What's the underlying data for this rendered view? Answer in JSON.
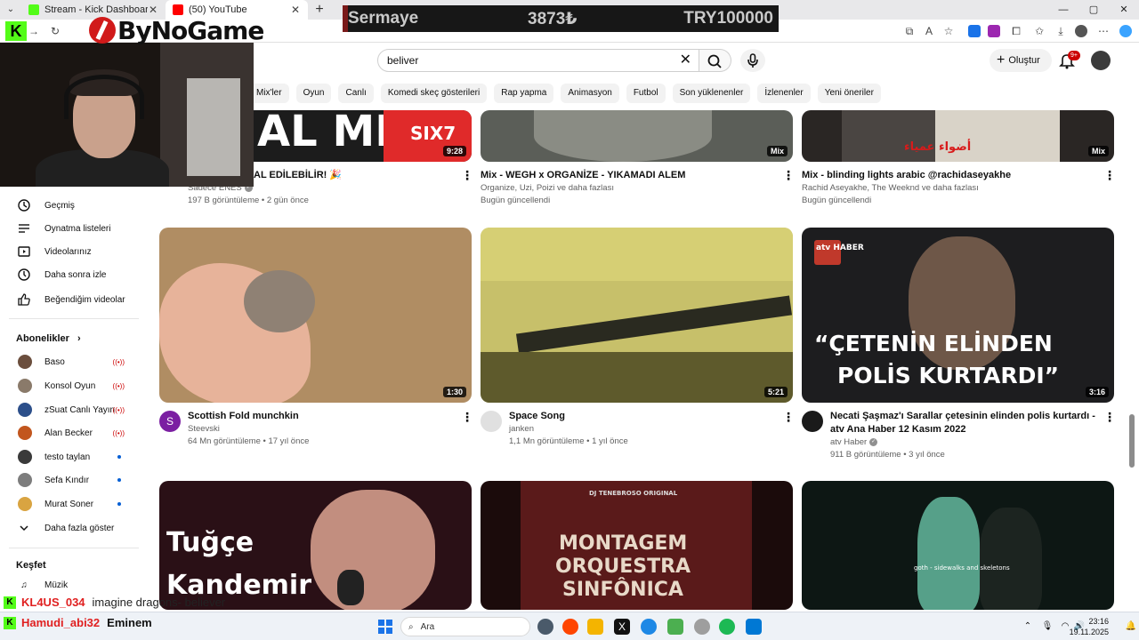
{
  "browser": {
    "tabs": [
      {
        "label": "Stream - Kick Dashboard",
        "active": false,
        "icon_color": "#53fc18"
      },
      {
        "label": "(50) YouTube",
        "active": true,
        "icon_color": "#ff0000"
      }
    ],
    "new_tab_symbol": "+",
    "window_controls": {
      "minimize": "—",
      "maximize": "▢",
      "close": "✕"
    }
  },
  "overlay": {
    "sermaye_label": "Sermaye",
    "sermaye_value": "3873₺",
    "sermaye_target": "TRY100000",
    "logo_text": "ByNoGame",
    "kick_badge": "K"
  },
  "youtube": {
    "search": {
      "value": "beliver",
      "placeholder": "Ara"
    },
    "create_label": "Oluştur",
    "notifications_badge": "9+",
    "chips": [
      "Mix'ler",
      "Oyun",
      "Canlı",
      "Komedi skeç gösterileri",
      "Rap yapma",
      "Animasyon",
      "Futbol",
      "Son yüklenenler",
      "İzlenenler",
      "Yeni öneriler"
    ]
  },
  "sidebar": {
    "you_items": [
      {
        "label": "Geçmiş",
        "icon": "history-icon"
      },
      {
        "label": "Oynatma listeleri",
        "icon": "playlist-icon"
      },
      {
        "label": "Videolarınız",
        "icon": "your-videos-icon"
      },
      {
        "label": "Daha sonra izle",
        "icon": "watch-later-icon"
      },
      {
        "label": "Beğendiğim videolar",
        "icon": "like-icon"
      }
    ],
    "subscriptions_heading": "Abonelikler",
    "subscriptions": [
      {
        "label": "Baso",
        "status": "live",
        "avatar_color": "#6b4e3d"
      },
      {
        "label": "Konsol Oyun",
        "status": "live",
        "avatar_color": "#8a7a6a"
      },
      {
        "label": "zSuat Canlı Yayın",
        "status": "live",
        "avatar_color": "#2c4f8a"
      },
      {
        "label": "Alan Becker",
        "status": "live",
        "avatar_color": "#c2561e"
      },
      {
        "label": "testo taylan",
        "status": "new",
        "avatar_color": "#3a3a3a"
      },
      {
        "label": "Sefa Kındır",
        "status": "new",
        "avatar_color": "#7d7d7d"
      },
      {
        "label": "Murat Soner",
        "status": "new",
        "avatar_color": "#d9a441"
      }
    ],
    "show_more_label": "Daha fazla göster",
    "explore_heading": "Keşfet",
    "explore_items": [
      {
        "label": "Müzik",
        "icon": "music-icon"
      }
    ]
  },
  "videos": {
    "row1": [
      {
        "title": "AL EDİLEBİLİR! 🎉",
        "channel": "Sadece ENES",
        "meta": "197 B görüntüleme • 2 gün önce",
        "duration": "9:28",
        "verified": true
      },
      {
        "title": "Mix - WEGH x ORGANİZE - YIKAMADI ALEM",
        "channel": "Organize, Uzi, Poizi ve daha fazlası",
        "meta": "Bugün güncellendi",
        "duration": "Mix"
      },
      {
        "title": "Mix - blinding lights arabic @rachidaseyakhe",
        "channel": "Rachid Aseyakhe, The Weeknd ve daha fazlası",
        "meta": "Bugün güncellendi",
        "duration": "Mix"
      }
    ],
    "row2": [
      {
        "title": "Scottish Fold munchkin",
        "channel": "Steevski",
        "meta": "64 Mn görüntüleme • 17 yıl önce",
        "duration": "1:30",
        "avatar_letter": "S",
        "avatar_color": "#7b1fa2"
      },
      {
        "title": "Space Song",
        "channel": "janken",
        "meta": "1,1 Mn görüntüleme • 1 yıl önce",
        "duration": "5:21",
        "avatar_letter": "",
        "avatar_color": "#e0e0e0"
      },
      {
        "title": "Necati Şaşmaz'ı Sarallar çetesinin elinden polis kurtardı - atv Ana Haber 12 Kasım 2022",
        "channel": "atv Haber",
        "meta": "911 B görüntüleme • 3 yıl önce",
        "duration": "3:16",
        "avatar_letter": "",
        "avatar_color": "#1a1a1a",
        "verified": true
      }
    ],
    "thumb_texts": {
      "r1a": "AL MI?",
      "r1a_brand": "SIX7",
      "r1c_arabic": "أضواء عمياء",
      "r2c_logo": "atv HABER",
      "r2c_quote_1": "“ÇETENİN ELİNDEN",
      "r2c_quote_2": "POLİS KURTARDI”",
      "r3a_1": "Tuğçe",
      "r3a_2": "Kandemir",
      "r3b_top": "DJ TENEBROSO ORIGINAL",
      "r3b_1": "MONTAGEM",
      "r3b_2": "ORQUESTRA",
      "r3b_3": "SINFÔNICA",
      "r3c": "goth - sidewalks and skeletons",
      "mix_label": "Mix"
    }
  },
  "chat": [
    {
      "user": "KL4US_034",
      "message": "imagine dragons- believer",
      "user_color": "#e02020"
    },
    {
      "user": "Hamudi_abi32",
      "message": "Eminem",
      "user_color": "#e02020"
    }
  ],
  "taskbar": {
    "search_label": "Ara",
    "time": "23:16",
    "date": "19.11.2025"
  },
  "colors": {
    "youtube_red": "#ff0000",
    "kick_green": "#53fc18",
    "live_red": "#cc0000"
  }
}
